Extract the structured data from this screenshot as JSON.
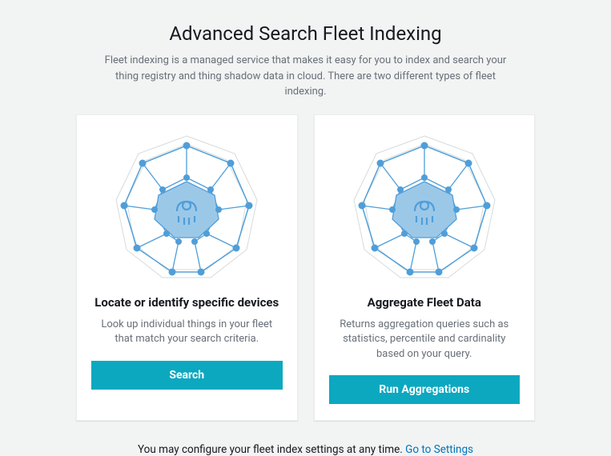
{
  "header": {
    "title": "Advanced Search Fleet Indexing",
    "subtitle": "Fleet indexing is a managed service that makes it easy for you to index and search your thing registry and thing shadow data in cloud. There are two different types of fleet indexing."
  },
  "cards": [
    {
      "title": "Locate or identify specific devices",
      "desc": "Look up individual things in your fleet that match your search criteria.",
      "button": "Search"
    },
    {
      "title": "Aggregate Fleet Data",
      "desc": "Returns aggregation queries such as statistics, percentile and cardinality based on your query.",
      "button": "Run Aggregations"
    }
  ],
  "footer": {
    "text": "You may configure your fleet index settings at any time. ",
    "link": "Go to Settings"
  }
}
